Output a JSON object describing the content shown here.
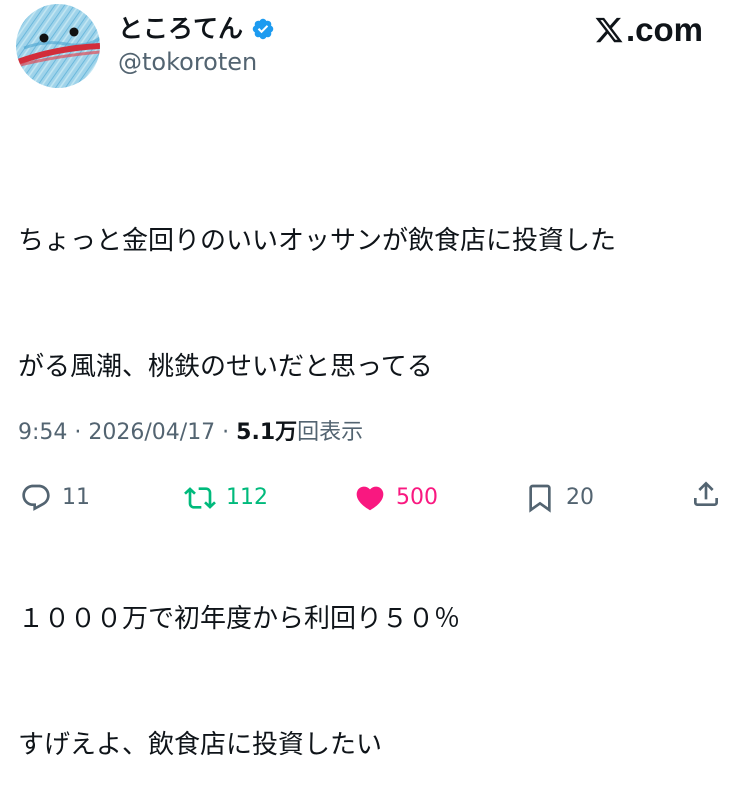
{
  "header": {
    "display_name": "ところてん",
    "handle": "@tokoroten",
    "brand": ".com",
    "verified_color": "#1d9bf0"
  },
  "tweet": {
    "lines": [
      "ちょっと金回りのいいオッサンが飲食店に投資した",
      "がる風潮、桃鉄のせいだと思ってる",
      "",
      "１０００万で初年度から利回り５０％",
      "すげえよ、飲食店に投資したい"
    ]
  },
  "meta": {
    "timestamp": "9:54 · 2026/04/17 · ",
    "views_count": "5.1万",
    "views_label": "回表示"
  },
  "actions": {
    "reply_count": "11",
    "retweet_count": "112",
    "like_count": "500",
    "bookmark_count": "20",
    "retweet_color": "#00ba7c",
    "like_color": "#f91880"
  }
}
